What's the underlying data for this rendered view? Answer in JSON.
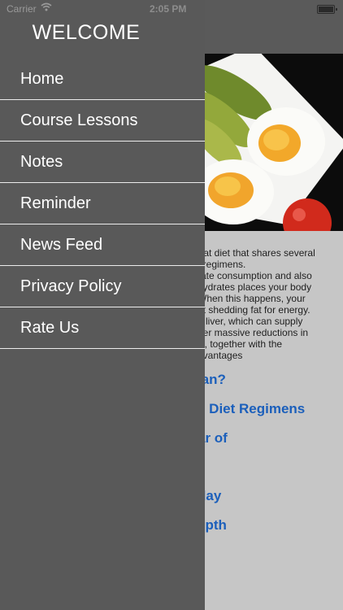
{
  "status_bar": {
    "carrier": "Carrier",
    "time": "2:05 PM"
  },
  "drawer": {
    "title": "WELCOME",
    "menu": [
      {
        "label": "Home"
      },
      {
        "label": "Course Lessons"
      },
      {
        "label": "Notes"
      },
      {
        "label": "Reminder"
      },
      {
        "label": "News Feed"
      },
      {
        "label": "Privacy Policy"
      },
      {
        "label": "Rate Us"
      }
    ]
  },
  "article": {
    "paragraph_lines": [
      "-fat diet that shares several",
      "t regimens.",
      "rate consumption and also",
      "hydrates places your body",
      "When this happens, your",
      "at shedding fat for energy.",
      "e liver, which can supply",
      "ger massive reductions in",
      "is, together with the",
      "dvantages"
    ],
    "toc": [
      "lan?",
      "c Diet Regimens",
      "ar of",
      "day",
      "epth"
    ]
  },
  "colors": {
    "drawer_bg": "#595959",
    "content_bg": "#c6c6c6",
    "link": "#1b5fbb",
    "divider": "#ececec"
  }
}
